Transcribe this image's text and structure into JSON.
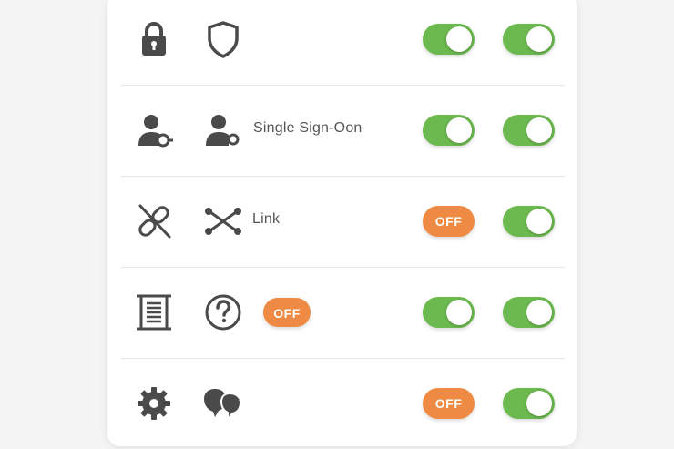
{
  "colors": {
    "toggle_on": "#6cb94f",
    "toggle_off": "#ee8a43",
    "icon": "#4a4a4a"
  },
  "rows": [
    {
      "icon_a": "padlock-icon",
      "icon_b": "shield-icon",
      "label": "",
      "inline_toggle": null,
      "toggle_1": {
        "state": "on",
        "text": ""
      },
      "toggle_2": {
        "state": "on",
        "text": ""
      }
    },
    {
      "icon_a": "user-key-icon",
      "icon_b": "user-key-icon",
      "label": "Single Sign-Oon",
      "inline_toggle": null,
      "toggle_1": {
        "state": "on",
        "text": ""
      },
      "toggle_2": {
        "state": "on",
        "text": ""
      }
    },
    {
      "icon_a": "broken-link-icon",
      "icon_b": "nodes-link-icon",
      "label": "Link",
      "inline_toggle": null,
      "toggle_1": {
        "state": "off",
        "text": "OFF"
      },
      "toggle_2": {
        "state": "on",
        "text": ""
      }
    },
    {
      "icon_a": "document-scroll-icon",
      "icon_b": "question-circle-icon",
      "label": "",
      "inline_toggle": {
        "state": "off",
        "text": "OFF"
      },
      "toggle_1": {
        "state": "on",
        "text": ""
      },
      "toggle_2": {
        "state": "on",
        "text": ""
      }
    },
    {
      "icon_a": "gear-icon",
      "icon_b": "chat-bubbles-icon",
      "label": "",
      "inline_toggle": null,
      "toggle_1": {
        "state": "off",
        "text": "OFF"
      },
      "toggle_2": {
        "state": "on",
        "text": ""
      }
    }
  ]
}
